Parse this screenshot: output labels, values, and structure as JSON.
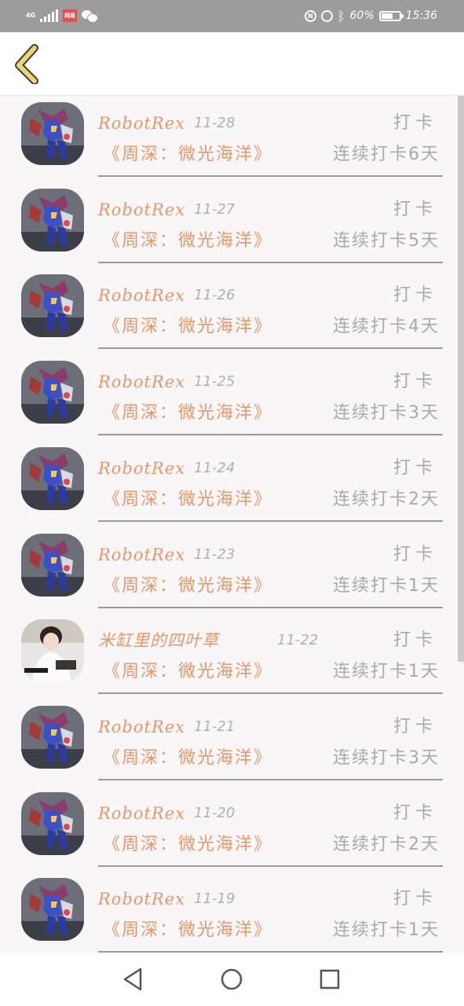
{
  "status_bar": {
    "network": "4G",
    "network_sub": "46",
    "app_badge": "网易",
    "battery_percent": "60%",
    "time": "15:36",
    "icons": [
      "signal-icon",
      "app-badge-icon",
      "wechat-icon",
      "nfc-icon",
      "alarm-icon",
      "bluetooth-icon",
      "battery-icon"
    ]
  },
  "header": {
    "back_icon": "chevron-left-icon"
  },
  "records": [
    {
      "user": "RobotRex",
      "date": "11-28",
      "tag": "打卡",
      "book": "《周深：微光海洋》",
      "streak": "连续打卡6天",
      "avatar": "robot"
    },
    {
      "user": "RobotRex",
      "date": "11-27",
      "tag": "打卡",
      "book": "《周深：微光海洋》",
      "streak": "连续打卡5天",
      "avatar": "robot"
    },
    {
      "user": "RobotRex",
      "date": "11-26",
      "tag": "打卡",
      "book": "《周深：微光海洋》",
      "streak": "连续打卡4天",
      "avatar": "robot"
    },
    {
      "user": "RobotRex",
      "date": "11-25",
      "tag": "打卡",
      "book": "《周深：微光海洋》",
      "streak": "连续打卡3天",
      "avatar": "robot"
    },
    {
      "user": "RobotRex",
      "date": "11-24",
      "tag": "打卡",
      "book": "《周深：微光海洋》",
      "streak": "连续打卡2天",
      "avatar": "robot"
    },
    {
      "user": "RobotRex",
      "date": "11-23",
      "tag": "打卡",
      "book": "《周深：微光海洋》",
      "streak": "连续打卡1天",
      "avatar": "robot"
    },
    {
      "user": "米缸里的四叶草",
      "date": "11-22",
      "tag": "打卡",
      "book": "《周深：微光海洋》",
      "streak": "连续打卡1天",
      "avatar": "person"
    },
    {
      "user": "RobotRex",
      "date": "11-21",
      "tag": "打卡",
      "book": "《周深：微光海洋》",
      "streak": "连续打卡3天",
      "avatar": "robot"
    },
    {
      "user": "RobotRex",
      "date": "11-20",
      "tag": "打卡",
      "book": "《周深：微光海洋》",
      "streak": "连续打卡2天",
      "avatar": "robot"
    },
    {
      "user": "RobotRex",
      "date": "11-19",
      "tag": "打卡",
      "book": "《周深：微光海洋》",
      "streak": "连续打卡1天",
      "avatar": "robot"
    }
  ],
  "nav_bar": {
    "buttons": [
      "back-triangle-icon",
      "home-circle-icon",
      "recents-square-icon"
    ]
  },
  "colors": {
    "accent": "#e7966a",
    "muted": "#a9a9a9",
    "back_icon": "#c8a83a",
    "background": "#f8f6f7"
  }
}
